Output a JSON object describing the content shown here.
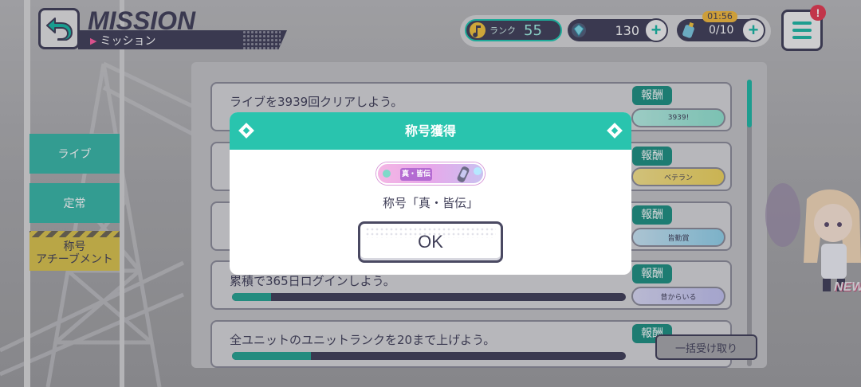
{
  "header": {
    "title": "MISSION",
    "subtitle": "ミッション"
  },
  "status": {
    "rank_label": "ランク",
    "rank_value": "55",
    "gems": "130",
    "energy_timer": "01:56",
    "energy": "0/10",
    "plus_symbol": "+",
    "notification": "!"
  },
  "nav": {
    "live": "ライブ",
    "regular": "定常",
    "title_line1": "称号",
    "title_line2": "アチーブメント"
  },
  "missions": [
    {
      "text": "ライブを3939回クリアしよう。",
      "reward_label": "報酬",
      "badge": "3939!",
      "progress": 0.0
    },
    {
      "text": "",
      "reward_label": "報酬",
      "badge": "ベテラン",
      "progress": 0.0
    },
    {
      "text": "",
      "reward_label": "報酬",
      "badge": "皆勤賞",
      "progress": 0.0
    },
    {
      "text": "累積で365日ログインしよう。",
      "reward_label": "報酬",
      "badge": "昔からいる",
      "progress": 0.1
    },
    {
      "text": "全ユニットのユニットランクを20まで上げよう。",
      "reward_label": "報酬",
      "badge": "",
      "progress": 0.2
    }
  ],
  "bulk_receive": "一括受け取り",
  "new_tag": "NEW",
  "modal": {
    "title": "称号獲得",
    "plate_tag": "真・皆伝",
    "message": "称号「真・皆伝」",
    "ok": "OK"
  },
  "colors": {
    "teal": "#29c4ae",
    "navy": "#3f3e57",
    "yellow": "#d9c24b"
  }
}
